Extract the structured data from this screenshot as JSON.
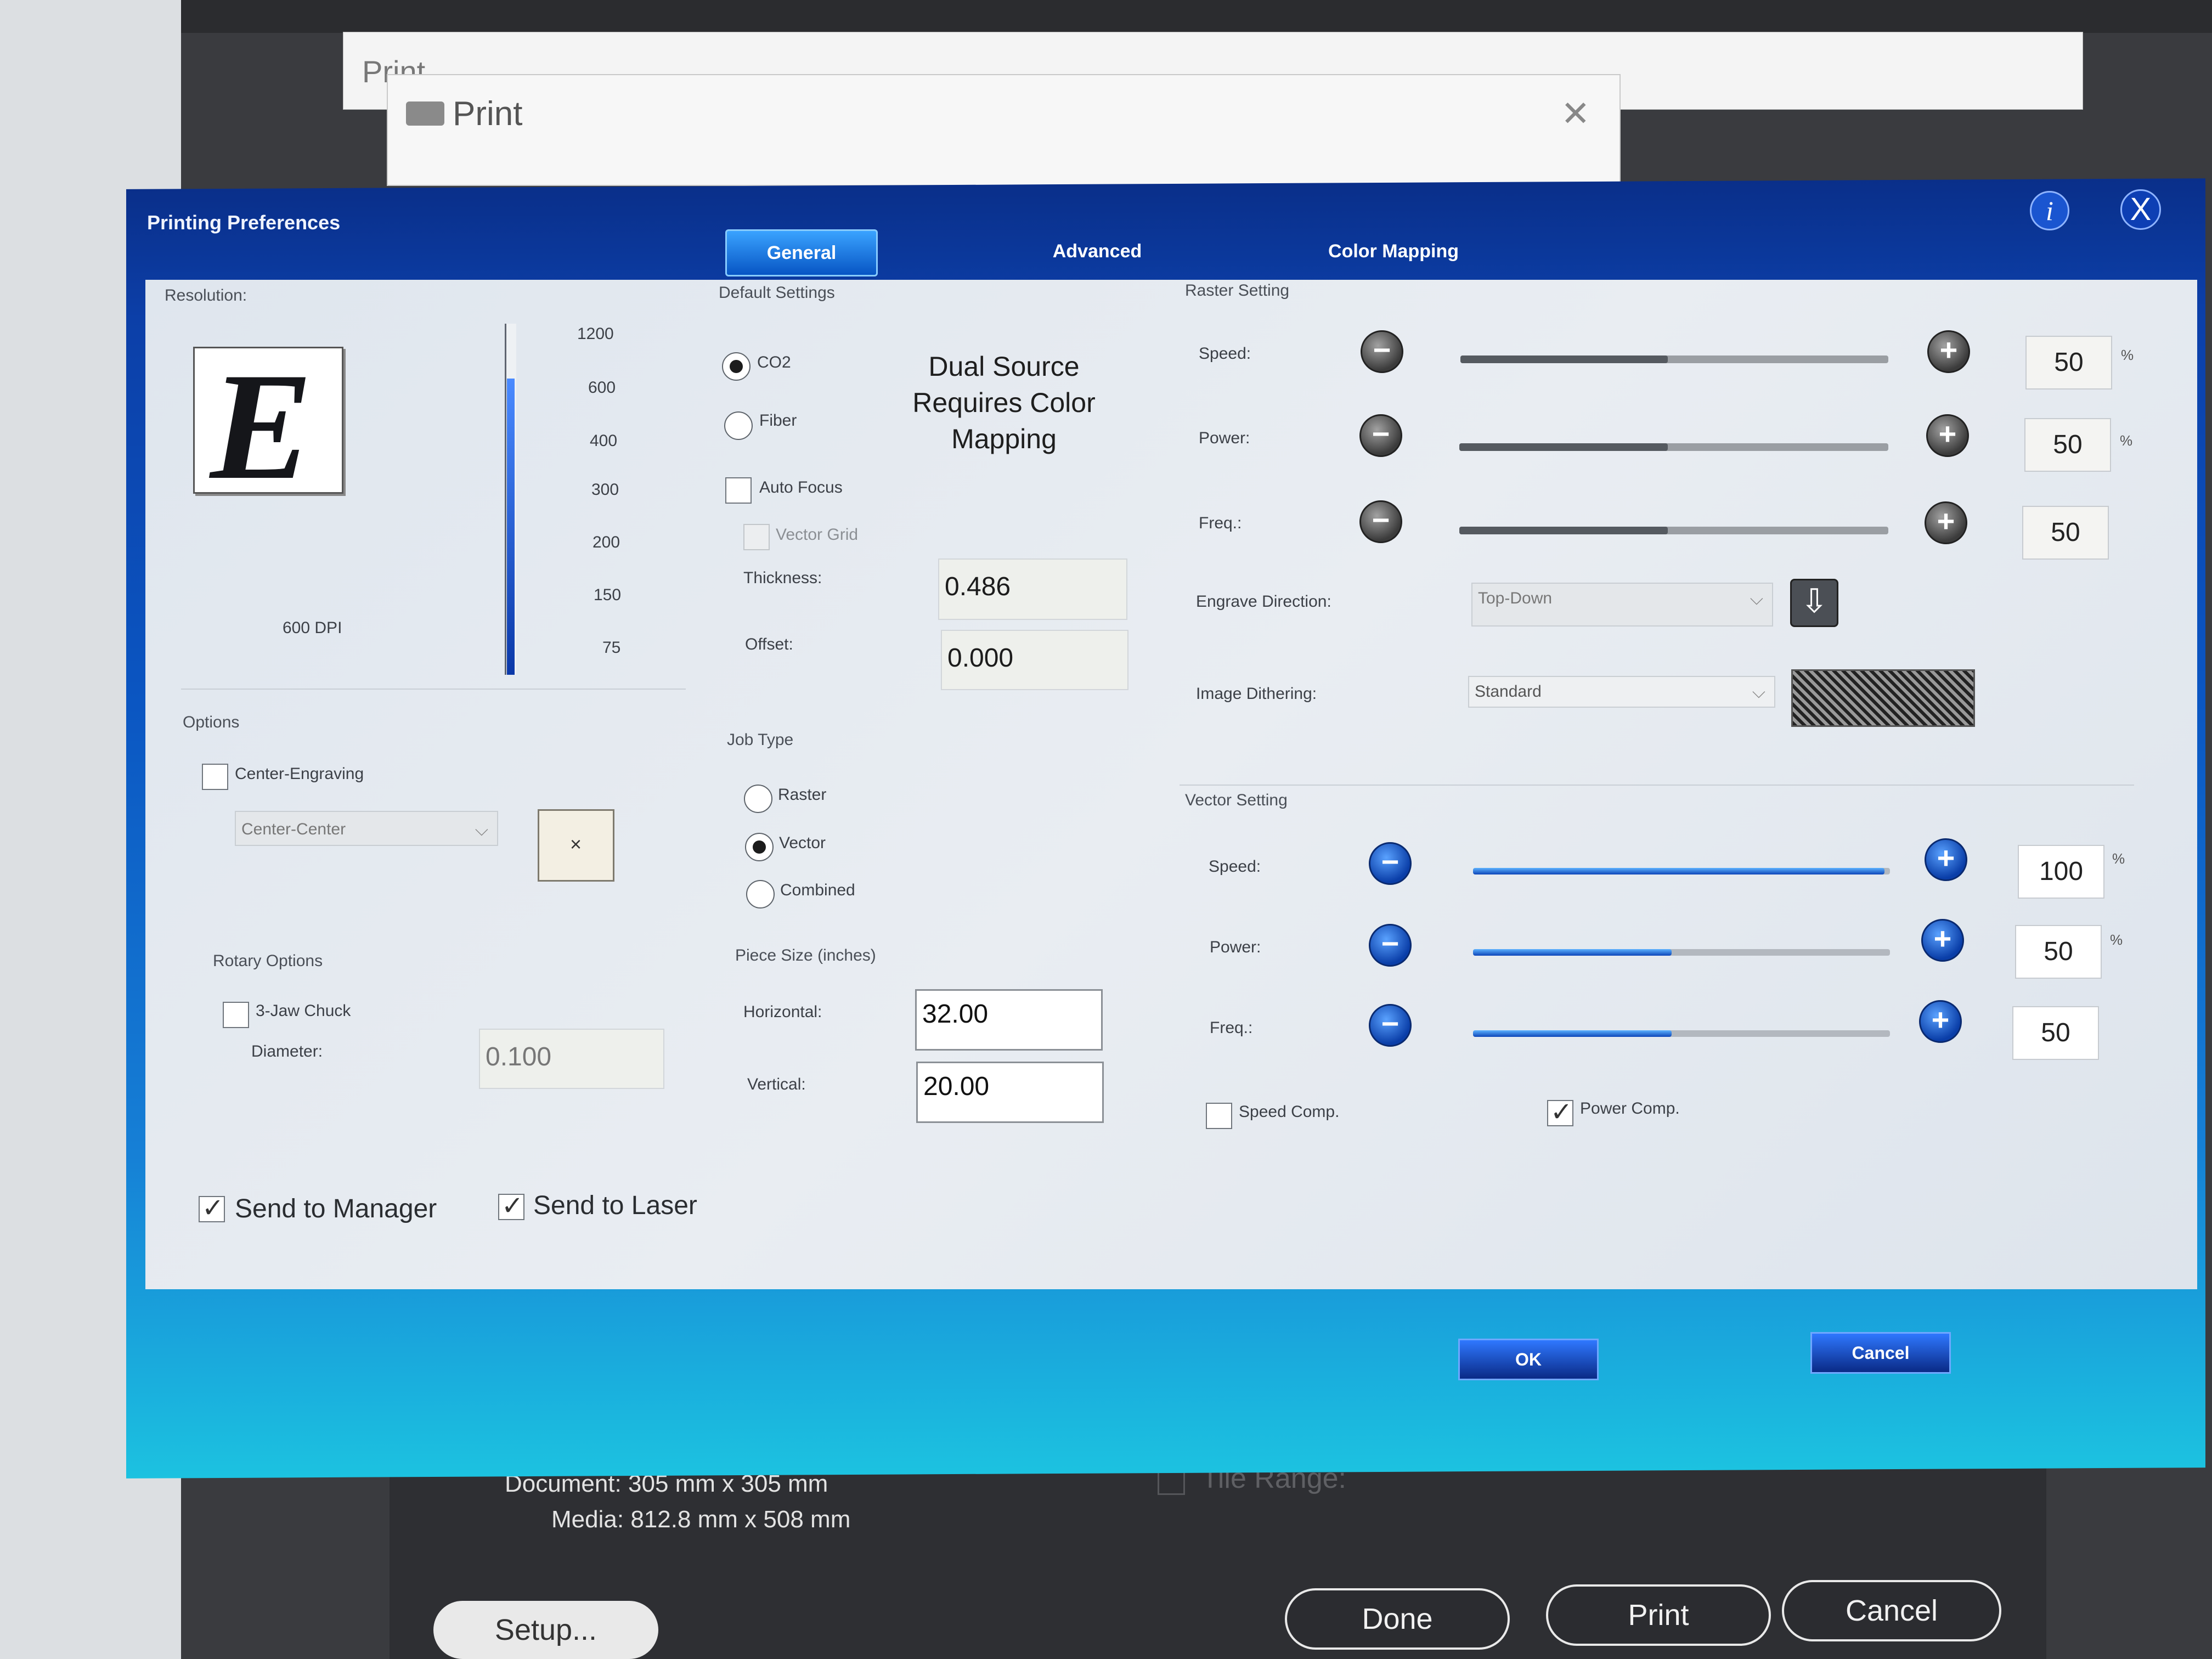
{
  "back_window": {
    "title": "Print"
  },
  "print_dialog": {
    "title": "Print",
    "document_label": "Document:",
    "document_value": "305 mm x 305 mm",
    "media_label": "Media:",
    "media_value": "812.8 mm x 508 mm",
    "tile_range_label": "Tile Range:",
    "setup_label": "Setup...",
    "done_label": "Done",
    "print_label": "Print",
    "cancel_label": "Cancel"
  },
  "prefs": {
    "title": "Printing Preferences",
    "close_glyph": "X",
    "info_glyph": "i",
    "tabs": [
      {
        "label": "General",
        "active": true
      },
      {
        "label": "Advanced",
        "active": false
      },
      {
        "label": "Color Mapping",
        "active": false
      }
    ],
    "resolution": {
      "header": "Resolution:",
      "logo_letter": "E",
      "current": "600 DPI",
      "levels": [
        "1200",
        "600",
        "400",
        "300",
        "200",
        "150",
        "75"
      ]
    },
    "options": {
      "header": "Options",
      "center_engraving_label": "Center-Engraving",
      "center_engraving_checked": false,
      "center_combo_value": "Center-Center",
      "center_box_glyph": "×"
    },
    "rotary": {
      "header": "Rotary Options",
      "chuck_label": "3-Jaw Chuck",
      "chuck_checked": false,
      "diameter_label": "Diameter:",
      "diameter_value": "0.100"
    },
    "default_settings": {
      "header": "Default Settings",
      "co2_label": "CO2",
      "fiber_label": "Fiber",
      "selected": "CO2",
      "dual_source_note": "Dual Source Requires Color Mapping",
      "auto_focus_label": "Auto Focus",
      "vector_grid_label": "Vector Grid",
      "thickness_label": "Thickness:",
      "thickness_value": "0.486",
      "offset_label": "Offset:",
      "offset_value": "0.000"
    },
    "job_type": {
      "header": "Job Type",
      "options": [
        "Raster",
        "Vector",
        "Combined"
      ],
      "selected": "Vector"
    },
    "piece_size": {
      "header": "Piece Size (inches)",
      "horizontal_label": "Horizontal:",
      "horizontal_value": "32.00",
      "vertical_label": "Vertical:",
      "vertical_value": "20.00"
    },
    "raster": {
      "header": "Raster Setting",
      "speed_label": "Speed:",
      "speed_value": "50",
      "power_label": "Power:",
      "power_value": "50",
      "freq_label": "Freq.:",
      "freq_value": "50",
      "percent": "%",
      "engrave_direction_label": "Engrave Direction:",
      "engrave_direction_value": "Top-Down",
      "image_dithering_label": "Image Dithering:",
      "image_dithering_value": "Standard"
    },
    "vector": {
      "header": "Vector Setting",
      "speed_label": "Speed:",
      "speed_value": "100",
      "power_label": "Power:",
      "power_value": "50",
      "freq_label": "Freq.:",
      "freq_value": "50",
      "percent": "%",
      "speed_comp_label": "Speed Comp.",
      "speed_comp_checked": false,
      "power_comp_label": "Power Comp.",
      "power_comp_checked": true
    },
    "send_to_manager_label": "Send to Manager",
    "send_to_laser_label": "Send to Laser",
    "ok_label": "OK",
    "cancel_label": "Cancel"
  },
  "colors": {
    "title_bar_blue": "#0a2f8a",
    "panel_gray": "#e2e8ef",
    "accent_blue": "#0d45b8"
  }
}
